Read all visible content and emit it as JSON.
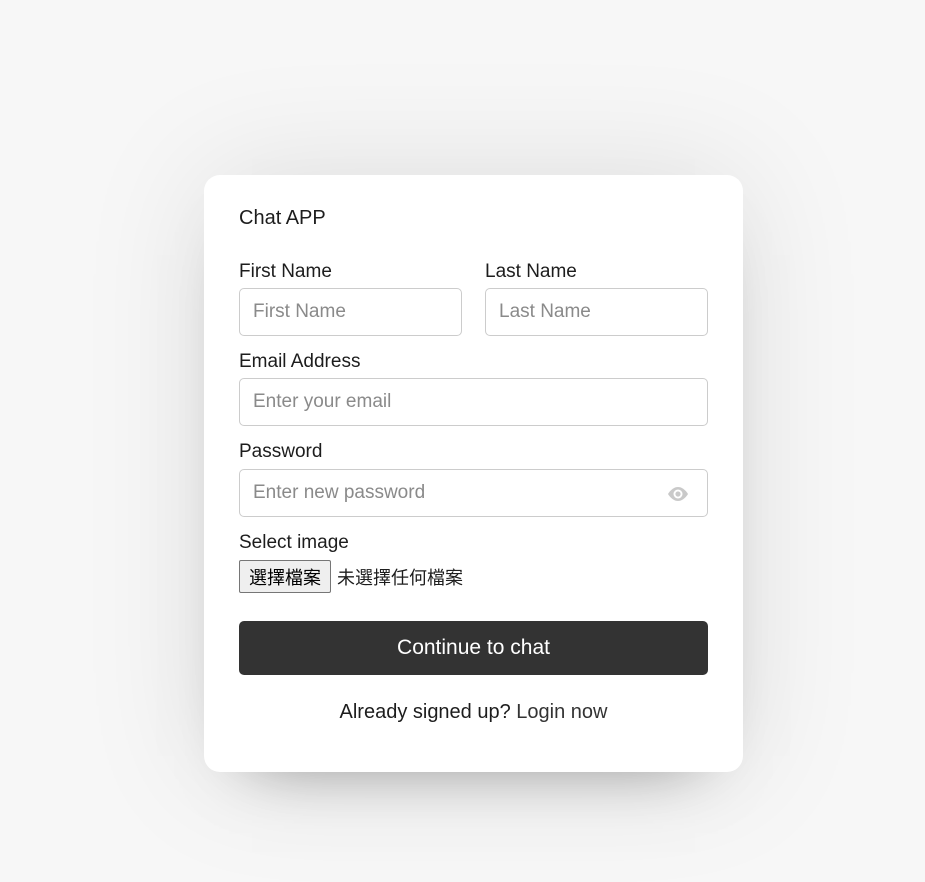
{
  "app": {
    "title": "Chat APP"
  },
  "form": {
    "first_name": {
      "label": "First Name",
      "placeholder": "First Name"
    },
    "last_name": {
      "label": "Last Name",
      "placeholder": "Last Name"
    },
    "email": {
      "label": "Email Address",
      "placeholder": "Enter your email"
    },
    "password": {
      "label": "Password",
      "placeholder": "Enter new password",
      "icon": "eye-icon"
    },
    "image": {
      "label": "Select image",
      "button_label": "選擇檔案",
      "status": "未選擇任何檔案"
    },
    "submit_label": "Continue to chat"
  },
  "footer": {
    "prompt": "Already signed up?",
    "link_label": "Login now"
  },
  "colors": {
    "background": "#f7f7f7",
    "card": "#ffffff",
    "button": "#333333",
    "border": "#cccccc"
  }
}
